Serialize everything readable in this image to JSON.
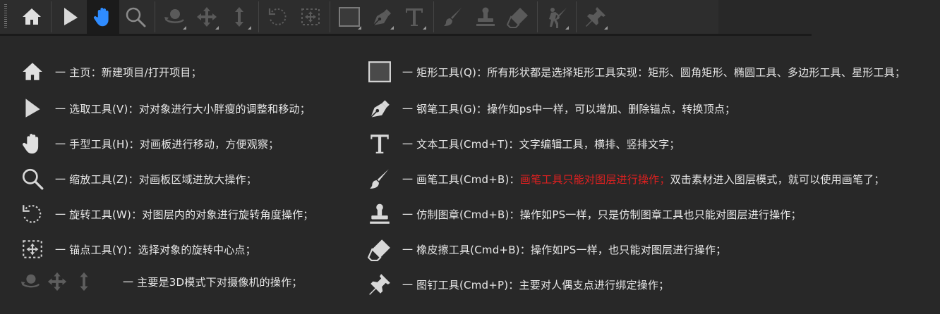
{
  "toolbar": {
    "tools": [
      {
        "name": "home",
        "icon": "home-icon"
      },
      {
        "name": "select",
        "icon": "arrow-pointer-icon"
      },
      {
        "name": "hand",
        "icon": "hand-icon",
        "active": true
      },
      {
        "name": "zoom",
        "icon": "magnifier-icon"
      },
      {
        "name": "orbit",
        "icon": "orbit-camera-icon"
      },
      {
        "name": "pan",
        "icon": "move-cross-icon"
      },
      {
        "name": "dolly",
        "icon": "vertical-arrows-icon"
      },
      {
        "name": "rotate",
        "icon": "rotate-icon"
      },
      {
        "name": "anchor",
        "icon": "anchor-point-icon"
      },
      {
        "name": "rectangle",
        "icon": "rectangle-icon"
      },
      {
        "name": "pen",
        "icon": "pen-nib-icon"
      },
      {
        "name": "text",
        "icon": "text-t-icon"
      },
      {
        "name": "brush",
        "icon": "brush-icon"
      },
      {
        "name": "stamp",
        "icon": "stamp-icon"
      },
      {
        "name": "eraser",
        "icon": "eraser-icon"
      },
      {
        "name": "roto",
        "icon": "roto-brush-icon"
      },
      {
        "name": "pin",
        "icon": "pin-icon"
      }
    ],
    "accent_color": "#2f8cff"
  },
  "legend_left": [
    {
      "icon": "home-icon",
      "text": "一 主页：新建项目/打开项目；"
    },
    {
      "icon": "arrow-pointer-icon",
      "text": "一 选取工具(V)：对对象进行大小胖瘦的调整和移动；"
    },
    {
      "icon": "hand-icon",
      "text": "一  手型工具(H)：对画板进行移动，方便观察；"
    },
    {
      "icon": "magnifier-icon",
      "text": "一  缩放工具(Z)：对画板区域进放大操作；"
    },
    {
      "icon": "rotate-icon",
      "text": "一  旋转工具(W)：对图层内的对象进行旋转角度操作；"
    },
    {
      "icon": "anchor-point-icon",
      "text": "一  锚点工具(Y)：选择对象的旋转中心点；"
    },
    {
      "icon": "camera-tools-icons",
      "text": "一  主要是3D模式下对摄像机的操作；"
    }
  ],
  "legend_right": [
    {
      "icon": "rectangle-icon",
      "text": "一  矩形工具(Q)：所有形状都是选择矩形工具实现：矩形、圆角矩形、椭圆工具、多边形工具、星形工具；"
    },
    {
      "icon": "pen-nib-icon",
      "text": "一  钢笔工具(G)：操作如ps中一样，可以增加、删除锚点，转换顶点；"
    },
    {
      "icon": "text-t-icon",
      "text": "一  文本工具(Cmd+T)：文字编辑工具，横排、竖排文字；"
    },
    {
      "icon": "brush-icon",
      "text": "一  画笔工具(Cmd+B)：",
      "highlight": "画笔工具只能对图层进行操作；",
      "text_after": "双击素材进入图层模式，就可以使用画笔了；",
      "highlight_color": "#e02020"
    },
    {
      "icon": "stamp-icon",
      "text": "一  仿制图章(Cmd+B)：操作如PS一样，只是仿制图章工具也只能对图层进行操作；"
    },
    {
      "icon": "eraser-icon",
      "text": "一  橡皮擦工具(Cmd+B)：操作如PS一样，也只能对图层进行操作；"
    },
    {
      "icon": "pin-icon",
      "text": "一  图钉工具(Cmd+P)：主要对人偶支点进行绑定操作；"
    }
  ]
}
